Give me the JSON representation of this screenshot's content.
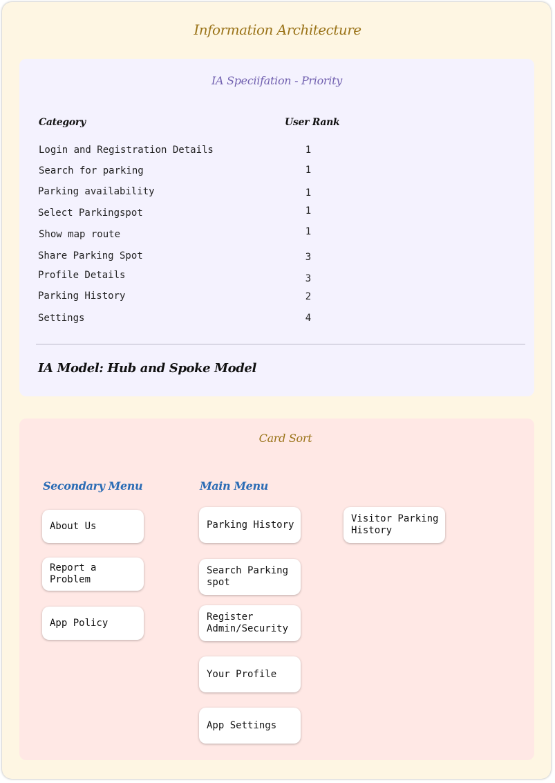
{
  "title": "Information Architecture",
  "ia_spec": {
    "title": "IA Speciifation - Priority",
    "columns": {
      "category": "Category",
      "rank": "User Rank"
    },
    "rows": [
      {
        "category": "Login and Registration Details",
        "rank": "1"
      },
      {
        "category": "Search for parking",
        "rank": "1"
      },
      {
        "category": "Parking availability",
        "rank": "1"
      },
      {
        "category": "Select Parkingspot",
        "rank": "1"
      },
      {
        "category": "Show map route",
        "rank": "1"
      },
      {
        "category": "Share Parking Spot",
        "rank": "3"
      },
      {
        "category": "Profile Details",
        "rank": "3"
      },
      {
        "category": "Parking History",
        "rank": "2"
      },
      {
        "category": "Settings",
        "rank": "4"
      }
    ],
    "model": "IA Model: Hub and Spoke Model"
  },
  "card_sort": {
    "title": "Card Sort",
    "secondary_menu": {
      "heading": "Secondary Menu",
      "cards": [
        "About Us",
        "Report a Problem",
        "App Policy"
      ]
    },
    "main_menu": {
      "heading": "Main Menu",
      "cards": [
        "Parking History",
        "Search Parking spot",
        "Register Admin/Security",
        "Your Profile",
        "App Settings"
      ]
    },
    "extra_cards": [
      "Visitor Parking History"
    ]
  },
  "colors": {
    "page_bg": "#fef6e3",
    "ia_panel_bg": "#f4f2fe",
    "card_sort_bg": "#ffe8e5",
    "title_gold": "#9a7318",
    "spec_purple": "#7261b0",
    "menu_blue": "#2b6cb5"
  }
}
